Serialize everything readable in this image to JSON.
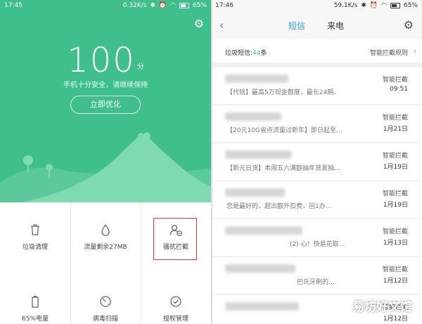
{
  "left": {
    "status": {
      "time": "17:45",
      "speed": "0.32K/s",
      "battery": "65%"
    },
    "score": {
      "value": "100",
      "unit": "分"
    },
    "tip": "手机十分安全，请继续保持",
    "optimize_label": "立即优化",
    "accent": "#3fbf8c",
    "grid": [
      {
        "label": "垃圾清理",
        "icon": "trash-icon"
      },
      {
        "label": "流量剩余27MB",
        "icon": "drop-icon"
      },
      {
        "label": "骚扰拦截",
        "icon": "user-block-icon"
      },
      {
        "label": "65%电量",
        "icon": "battery-icon"
      },
      {
        "label": "病毒扫描",
        "icon": "scan-icon"
      },
      {
        "label": "授权管理",
        "icon": "check-icon"
      }
    ]
  },
  "right": {
    "status": {
      "time": "17:46",
      "speed": "59.1K/s",
      "battery": "65%"
    },
    "tabs": {
      "sms": "短信",
      "calls": "来电"
    },
    "info": {
      "prefix": "垃圾短信:",
      "count": "44",
      "suffix": "条",
      "rule": "智能拦截规则"
    },
    "messages": [
      {
        "preview": "【代钱】最高5万现金额度，最长24期。",
        "tag": "智能拦截",
        "date": "09:51"
      },
      {
        "preview": "【20元10G省点流量过新年】即日起至…",
        "tag": "智能拦截",
        "date": "1月21日"
      },
      {
        "preview": "【新元日货】本周五六满额抽年货发抽…",
        "tag": "智能拦截",
        "date": "1月19日"
      },
      {
        "preview": "您是最好的，超出额外扣费，回1办…",
        "tag": "智能拦截",
        "date": "1月19日"
      },
      {
        "preview": "(2) 心！快易花取…",
        "tag": "智能拦截",
        "date": "1月13日"
      },
      {
        "preview": "巴氏牙刷的…",
        "tag": "智能拦截",
        "date": "1月12日"
      },
      {
        "preview": "",
        "tag": "智能拦截",
        "date": "1月12日"
      }
    ],
    "accent": "#2b9de0"
  },
  "watermark": "易坊好文馆"
}
